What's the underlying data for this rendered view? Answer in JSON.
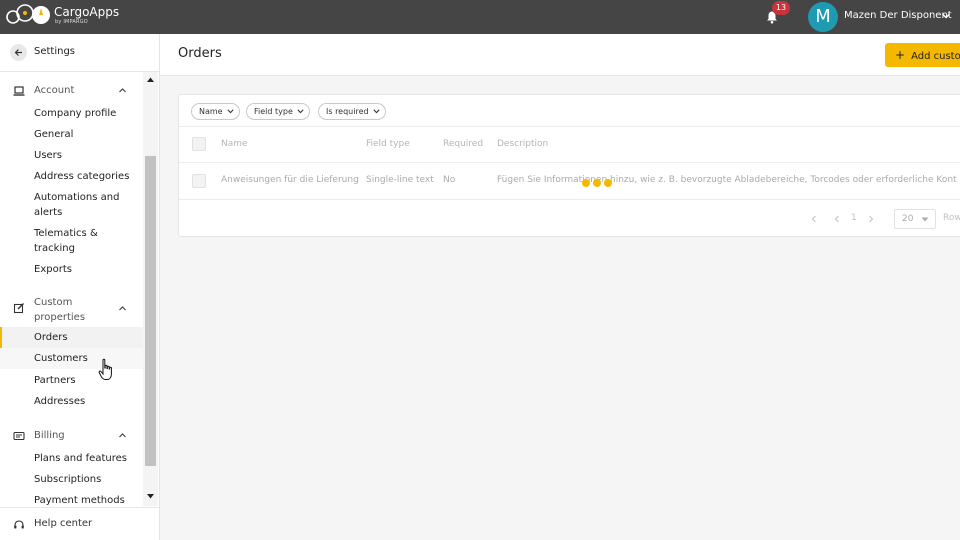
{
  "app": {
    "brand": "CargoApps",
    "brand_sub": "by IMPARGO",
    "notifications_count": "13",
    "user_initial": "M",
    "user_name": "Mazen Der Disponent"
  },
  "sidebar": {
    "back_label": "Settings",
    "groups": [
      {
        "label": "Account",
        "icon": "laptop-icon",
        "items": [
          "Company profile",
          "General",
          "Users",
          "Address categories",
          "Automations and alerts",
          "Telematics & tracking",
          "Exports"
        ]
      },
      {
        "label": "Custom properties",
        "icon": "edit-icon",
        "items": [
          "Orders",
          "Customers",
          "Partners",
          "Addresses"
        ]
      },
      {
        "label": "Billing",
        "icon": "billing-card-icon",
        "items": [
          "Plans and features",
          "Subscriptions",
          "Payment methods"
        ]
      }
    ],
    "active_item": "Orders",
    "help_label": "Help center"
  },
  "main": {
    "title": "Orders",
    "add_button": "Add custom",
    "filters": [
      "Name",
      "Field type",
      "Is required"
    ],
    "columns": [
      "Name",
      "Field type",
      "Required",
      "Description"
    ],
    "rows": [
      {
        "name": "Anweisungen für die Lieferung",
        "field_type": "Single-line text",
        "required": "No",
        "description": "Fügen Sie Informationen hinzu, wie z. B. bevorzugte Abladebereiche, Torcodes oder erforderliche Kont"
      }
    ],
    "pagination": {
      "current_page": "1",
      "page_size": "20",
      "rows_label": "Row"
    }
  },
  "colors": {
    "accent": "#f5b800",
    "topbar": "#454545",
    "badge": "#c8343c",
    "avatar": "#1e9bb0"
  }
}
